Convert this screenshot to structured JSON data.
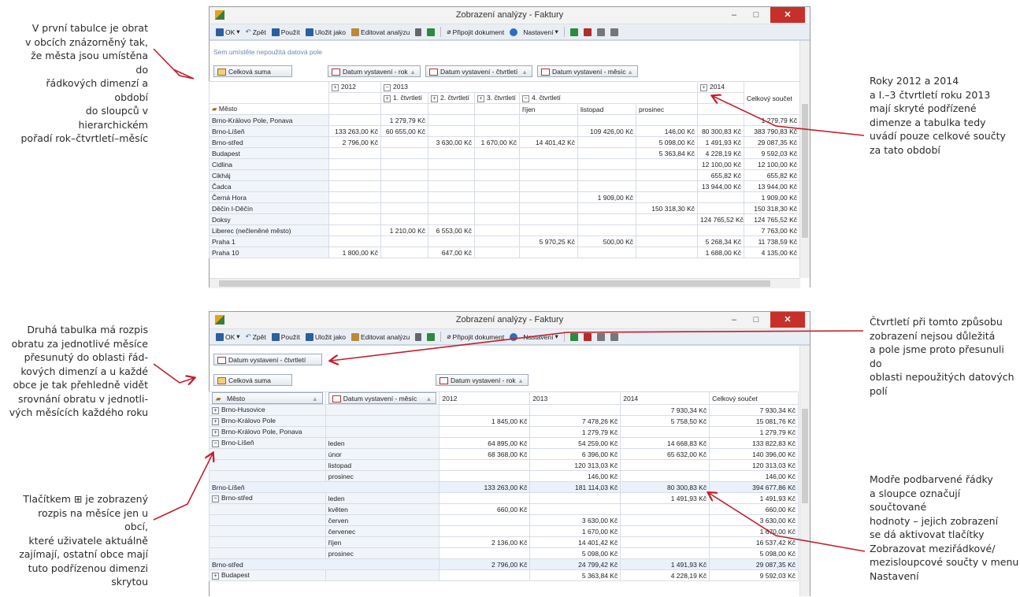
{
  "annotations": {
    "a1": [
      "V první tabulce je obrat",
      "v obcích znázorněný tak,",
      "že města jsou umístěna do",
      "řádkových dimenzí a období",
      "do sloupců v hierarchickém",
      "pořadí rok–čtvrtletí–měsíc"
    ],
    "a2": [
      "Roky 2012 a 2014",
      "a I.–3 čtvrtletí roku 2013",
      "mají skryté podřízené",
      "dimenze a tabulka tedy",
      "uvádí pouze celkové součty",
      "za tato období"
    ],
    "a3": [
      "Čtvrtletí při tomto způsobu",
      "zobrazení nejsou důležitá",
      "a pole jsme proto přesunuli do",
      "oblasti nepoužitých datových",
      "polí"
    ],
    "a4": [
      "Druhá tabulka má rozpis",
      "obratu za jednotlivé měsíce",
      "přesunutý do oblasti řád-",
      "kových dimenzí a u každé",
      "obce je tak přehledně vidět",
      "srovnání obratu v jednotli-",
      "vých měsících každého roku"
    ],
    "a5": [
      "Tlačítkem ⊞ je zobrazený",
      "rozpis na měsíce jen u obcí,",
      "které uživatele aktuálně",
      "zajímají, ostatní obce mají",
      "tuto podřízenou dimenzi",
      "skrytou"
    ],
    "a6": [
      "Modře podbarvené řádky",
      "a sloupce označují součtované",
      "hodnoty – jejich zobrazení",
      "se dá aktivovat tlačítky",
      "Zobrazovat meziřádkové/",
      "mezisloupcové součty v menu",
      "Nastavení"
    ]
  },
  "window": {
    "title": "Zobrazení analýzy - Faktury",
    "min": "–",
    "max": "□",
    "close": "✕"
  },
  "toolbar": {
    "ok": "OK",
    "dropdown_arrow": "▾",
    "back": "Zpět",
    "use": "Použít",
    "save_as": "Uložit jako",
    "edit": "Editovat analýzu",
    "attach": "Připojit dokument",
    "settings": "Nastavení"
  },
  "table1": {
    "hint": "Sem umístěte nepoužitá datová pole",
    "total_btn": "Celková suma",
    "field_year": "Datum vystavení - rok",
    "field_quarter": "Datum vystavení - čtvrtletí",
    "field_month": "Datum vystavení - měsíc",
    "row_field": "Město",
    "col_2012": "2012",
    "col_2013": "2013",
    "col_2014": "2014",
    "col_total": "Celkový součet",
    "q1": "1. čtvrtletí",
    "q2": "2. čtvrtletí",
    "q3": "3. čtvrtletí",
    "q4": "4. čtvrtletí",
    "m_oct": "říjen",
    "m_nov": "listopad",
    "m_dec": "prosinec",
    "rows": [
      {
        "name": "Brno-Královo Pole, Ponava",
        "v": [
          "",
          "1 279,79 Kč",
          "",
          "",
          "",
          "",
          "",
          "",
          "1 279,79 Kč"
        ]
      },
      {
        "name": "Brno-Líšeň",
        "v": [
          "133 263,00 Kč",
          "60 655,00 Kč",
          "",
          "",
          "",
          "109 426,00 Kč",
          "146,00 Kč",
          "80 300,83 Kč",
          "383 790,83 Kč"
        ]
      },
      {
        "name": "Brno-střed",
        "v": [
          "2 796,00 Kč",
          "",
          "3 630,00 Kč",
          "1 670,00 Kč",
          "14 401,42 Kč",
          "",
          "5 098,00 Kč",
          "1 491,93 Kč",
          "29 087,35 Kč"
        ]
      },
      {
        "name": "Budapest",
        "v": [
          "",
          "",
          "",
          "",
          "",
          "",
          "5 363,84 Kč",
          "4 228,19 Kč",
          "9 592,03 Kč"
        ]
      },
      {
        "name": "Cidlina",
        "v": [
          "",
          "",
          "",
          "",
          "",
          "",
          "",
          "12 100,00 Kč",
          "12 100,00 Kč"
        ]
      },
      {
        "name": "Cikháj",
        "v": [
          "",
          "",
          "",
          "",
          "",
          "",
          "",
          "655,82 Kč",
          "655,82 Kč"
        ]
      },
      {
        "name": "Čadca",
        "v": [
          "",
          "",
          "",
          "",
          "",
          "",
          "",
          "13 944,00 Kč",
          "13 944,00 Kč"
        ]
      },
      {
        "name": "Černá Hora",
        "v": [
          "",
          "",
          "",
          "",
          "",
          "1 909,00 Kč",
          "",
          "",
          "1 909,00 Kč"
        ]
      },
      {
        "name": "Děčín I-Děčín",
        "v": [
          "",
          "",
          "",
          "",
          "",
          "",
          "150 318,30 Kč",
          "",
          "150 318,30 Kč"
        ]
      },
      {
        "name": "Doksy",
        "v": [
          "",
          "",
          "",
          "",
          "",
          "",
          "",
          "124 765,52 Kč",
          "124 765,52 Kč"
        ]
      },
      {
        "name": "Liberec (nečleněné město)",
        "v": [
          "",
          "1 210,00 Kč",
          "6 553,00 Kč",
          "",
          "",
          "",
          "",
          "",
          "7 763,00 Kč"
        ]
      },
      {
        "name": "Praha 1",
        "v": [
          "",
          "",
          "",
          "",
          "5 970,25 Kč",
          "500,00 Kč",
          "",
          "5 268,34 Kč",
          "11 738,59 Kč"
        ]
      },
      {
        "name": "Praha 10",
        "v": [
          "1 800,00 Kč",
          "",
          "647,00 Kč",
          "",
          "",
          "",
          "",
          "1 688,00 Kč",
          "4 135,00 Kč"
        ]
      }
    ]
  },
  "table2": {
    "unused_field": "Datum vystavení - čtvrtletí",
    "total_btn": "Celková suma",
    "col_field": "Datum vystavení - rok",
    "row_field_city": "Město",
    "row_field_month": "Datum vystavení - měsíc",
    "col_2012": "2012",
    "col_2013": "2013",
    "col_2014": "2014",
    "col_total": "Celkový součet",
    "rows": [
      {
        "pm": "+",
        "city": "Brno-Husovice",
        "month": "",
        "v": [
          "",
          "",
          "7 930,34 Kč",
          "7 930,34 Kč"
        ],
        "sub": false
      },
      {
        "pm": "+",
        "city": "Brno-Královo Pole",
        "month": "",
        "v": [
          "1 845,00 Kč",
          "7 478,26 Kč",
          "5 758,50 Kč",
          "15 081,76 Kč"
        ],
        "sub": false
      },
      {
        "pm": "+",
        "city": "Brno-Královo Pole, Ponava",
        "month": "",
        "v": [
          "",
          "1 279,79 Kč",
          "",
          "1 279,79 Kč"
        ],
        "sub": false
      },
      {
        "pm": "−",
        "city": "Brno-Líšeň",
        "month": "leden",
        "v": [
          "64 895,00 Kč",
          "54 259,00 Kč",
          "14 668,83 Kč",
          "133 822,83 Kč"
        ],
        "sub": false
      },
      {
        "pm": "",
        "city": "",
        "month": "únor",
        "v": [
          "68 368,00 Kč",
          "6 396,00 Kč",
          "65 632,00 Kč",
          "140 396,00 Kč"
        ],
        "sub": false
      },
      {
        "pm": "",
        "city": "",
        "month": "listopad",
        "v": [
          "",
          "120 313,03 Kč",
          "",
          "120 313,03 Kč"
        ],
        "sub": false
      },
      {
        "pm": "",
        "city": "",
        "month": "prosinec",
        "v": [
          "",
          "146,00 Kč",
          "",
          "146,00 Kč"
        ],
        "sub": false
      },
      {
        "pm": "",
        "city": "Brno-Líšeň",
        "month": "",
        "v": [
          "133 263,00 Kč",
          "181 114,03 Kč",
          "80 300,83 Kč",
          "394 677,86 Kč"
        ],
        "sub": true
      },
      {
        "pm": "−",
        "city": "Brno-střed",
        "month": "leden",
        "v": [
          "",
          "",
          "1 491,93 Kč",
          "1 491,93 Kč"
        ],
        "sub": false
      },
      {
        "pm": "",
        "city": "",
        "month": "květen",
        "v": [
          "660,00 Kč",
          "",
          "",
          "660,00 Kč"
        ],
        "sub": false
      },
      {
        "pm": "",
        "city": "",
        "month": "červen",
        "v": [
          "",
          "3 630,00 Kč",
          "",
          "3 630,00 Kč"
        ],
        "sub": false
      },
      {
        "pm": "",
        "city": "",
        "month": "červenec",
        "v": [
          "",
          "1 670,00 Kč",
          "",
          "1 670,00 Kč"
        ],
        "sub": false
      },
      {
        "pm": "",
        "city": "",
        "month": "říjen",
        "v": [
          "2 136,00 Kč",
          "14 401,42 Kč",
          "",
          "16 537,42 Kč"
        ],
        "sub": false
      },
      {
        "pm": "",
        "city": "",
        "month": "prosinec",
        "v": [
          "",
          "5 098,00 Kč",
          "",
          "5 098,00 Kč"
        ],
        "sub": false
      },
      {
        "pm": "",
        "city": "Brno-střed",
        "month": "",
        "v": [
          "2 796,00 Kč",
          "24 799,42 Kč",
          "1 491,93 Kč",
          "29 087,35 Kč"
        ],
        "sub": true
      },
      {
        "pm": "+",
        "city": "Budapest",
        "month": "",
        "v": [
          "",
          "5 363,84 Kč",
          "4 228,19 Kč",
          "9 592,03 Kč"
        ],
        "sub": false
      }
    ]
  },
  "colors": {
    "annotation_arrow": "#c41e2a",
    "subtotal_row": "#eaf1fb",
    "header_bg": "#f1f5fa"
  }
}
